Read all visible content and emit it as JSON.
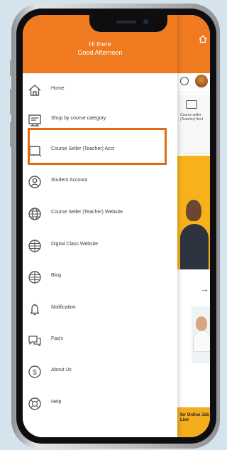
{
  "drawer": {
    "greeting_line1": "Hi there",
    "greeting_line2": "Good Afternoon",
    "header_color": "#f07a1f",
    "highlight_color": "#e06a12",
    "highlighted_item": "Course Seller (Teacher) Acct",
    "items": [
      {
        "label": "Home",
        "icon": "home-icon"
      },
      {
        "label": "Shop by course category",
        "icon": "shop-icon"
      },
      {
        "label": "Course Seller (Teacher) Acct",
        "icon": "tablet-icon"
      },
      {
        "label": "Student Account",
        "icon": "user-circle-icon"
      },
      {
        "label": "Course Seller (Teacher) Website",
        "icon": "globe-icon"
      },
      {
        "label": "Digital Class Website",
        "icon": "globe-icon"
      },
      {
        "label": "Blog",
        "icon": "globe-icon"
      },
      {
        "label": "Notification",
        "icon": "bell-icon"
      },
      {
        "label": "Faq's",
        "icon": "chat-icon"
      },
      {
        "label": "About Us",
        "icon": "dollar-icon"
      },
      {
        "label": "Help",
        "icon": "help-icon"
      }
    ]
  },
  "background_app": {
    "card_text": "Course seller (Teacher) Acct",
    "bottom_banner": "for Online Job Live"
  }
}
